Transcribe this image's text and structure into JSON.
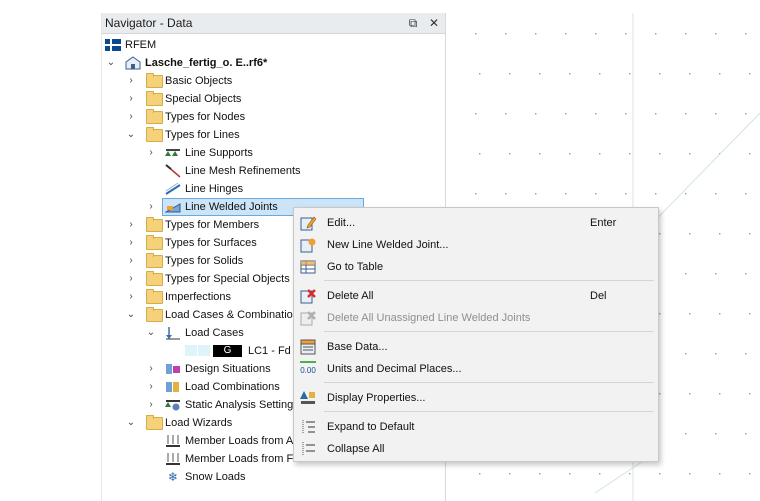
{
  "navigator": {
    "title": "Navigator - Data",
    "restore_label": "⧉",
    "close_label": "✕",
    "items": [
      {
        "label": "RFEM"
      },
      {
        "label": "Lasche_fertig_o. E..rf6*"
      },
      {
        "label": "Basic Objects"
      },
      {
        "label": "Special Objects"
      },
      {
        "label": "Types for Nodes"
      },
      {
        "label": "Types for Lines"
      },
      {
        "label": "Line Supports"
      },
      {
        "label": "Line Mesh Refinements"
      },
      {
        "label": "Line Hinges"
      },
      {
        "label": "Line Welded Joints"
      },
      {
        "label": "Types for Members"
      },
      {
        "label": "Types for Surfaces"
      },
      {
        "label": "Types for Solids"
      },
      {
        "label": "Types for Special Objects"
      },
      {
        "label": "Imperfections"
      },
      {
        "label": "Load Cases & Combinations"
      },
      {
        "label": "Load Cases"
      },
      {
        "label": "LC1 - Fd"
      },
      {
        "label": "Design Situations"
      },
      {
        "label": "Load Combinations"
      },
      {
        "label": "Static Analysis Settings"
      },
      {
        "label": "Load Wizards"
      },
      {
        "label": "Member Loads from Area Load"
      },
      {
        "label": "Member Loads from Free Line Load"
      },
      {
        "label": "Snow Loads"
      }
    ],
    "lc_badge": "G"
  },
  "context_menu": {
    "items": [
      {
        "label": "Edit...",
        "shortcut": "Enter",
        "icon": "edit-icon"
      },
      {
        "label": "New Line Welded Joint...",
        "shortcut": "",
        "icon": "new-object-icon"
      },
      {
        "label": "Go to Table",
        "shortcut": "",
        "icon": "table-icon"
      },
      {
        "label": "Delete All",
        "shortcut": "Del",
        "icon": "delete-icon"
      },
      {
        "label": "Delete All Unassigned Line Welded Joints",
        "shortcut": "",
        "icon": "delete-unassigned-icon",
        "disabled": true
      },
      {
        "label": "Base Data...",
        "shortcut": "",
        "icon": "base-data-icon"
      },
      {
        "label": "Units and Decimal Places...",
        "shortcut": "",
        "icon": "units-icon"
      },
      {
        "label": "Display Properties...",
        "shortcut": "",
        "icon": "display-properties-icon"
      },
      {
        "label": "Expand to Default",
        "shortcut": "",
        "icon": "expand-icon"
      },
      {
        "label": "Collapse All",
        "shortcut": "",
        "icon": "collapse-icon"
      }
    ],
    "units_icon_text": "0.00"
  }
}
